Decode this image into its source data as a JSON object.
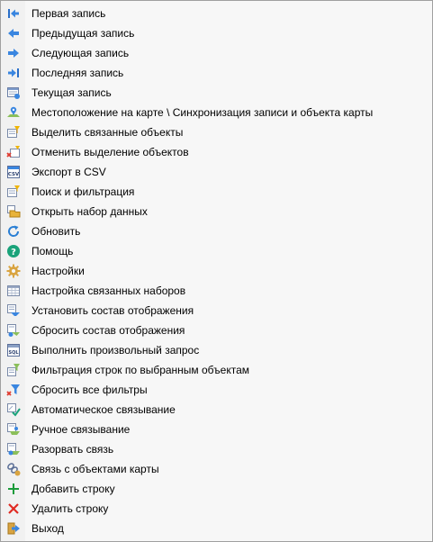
{
  "menu": {
    "items": [
      {
        "label": "Первая запись",
        "icon": "first-record-icon"
      },
      {
        "label": "Предыдущая запись",
        "icon": "previous-record-icon"
      },
      {
        "label": "Следующая запись",
        "icon": "next-record-icon"
      },
      {
        "label": "Последняя запись",
        "icon": "last-record-icon"
      },
      {
        "label": "Текущая запись",
        "icon": "current-record-icon"
      },
      {
        "label": "Местоположение на карте \\ Синхронизация записи и объекта карты",
        "icon": "map-location-icon"
      },
      {
        "label": "Выделить связанные объекты",
        "icon": "select-linked-icon"
      },
      {
        "label": "Отменить выделение объектов",
        "icon": "deselect-objects-icon"
      },
      {
        "label": "Экспорт в CSV",
        "icon": "csv-export-icon"
      },
      {
        "label": "Поиск и фильтрация",
        "icon": "search-filter-icon"
      },
      {
        "label": "Открыть набор данных",
        "icon": "open-dataset-icon"
      },
      {
        "label": "Обновить",
        "icon": "refresh-icon"
      },
      {
        "label": "Помощь",
        "icon": "help-icon"
      },
      {
        "label": "Настройки",
        "icon": "settings-icon"
      },
      {
        "label": "Настройка связанных наборов",
        "icon": "linked-sets-settings-icon"
      },
      {
        "label": "Установить состав отображения",
        "icon": "set-display-icon"
      },
      {
        "label": "Сбросить состав отображения",
        "icon": "reset-display-icon"
      },
      {
        "label": "Выполнить произвольный запрос",
        "icon": "custom-query-icon"
      },
      {
        "label": "Фильтрация строк по выбранным объектам",
        "icon": "filter-by-objects-icon"
      },
      {
        "label": "Сбросить все фильтры",
        "icon": "reset-filters-icon"
      },
      {
        "label": "Автоматическое связывание",
        "icon": "auto-link-icon"
      },
      {
        "label": "Ручное связывание",
        "icon": "manual-link-icon"
      },
      {
        "label": "Разорвать связь",
        "icon": "break-link-icon"
      },
      {
        "label": "Связь с объектами карты",
        "icon": "map-objects-link-icon"
      },
      {
        "label": "Добавить строку",
        "icon": "add-row-icon"
      },
      {
        "label": "Удалить строку",
        "icon": "delete-row-icon"
      },
      {
        "label": "Выход",
        "icon": "exit-icon"
      }
    ]
  }
}
